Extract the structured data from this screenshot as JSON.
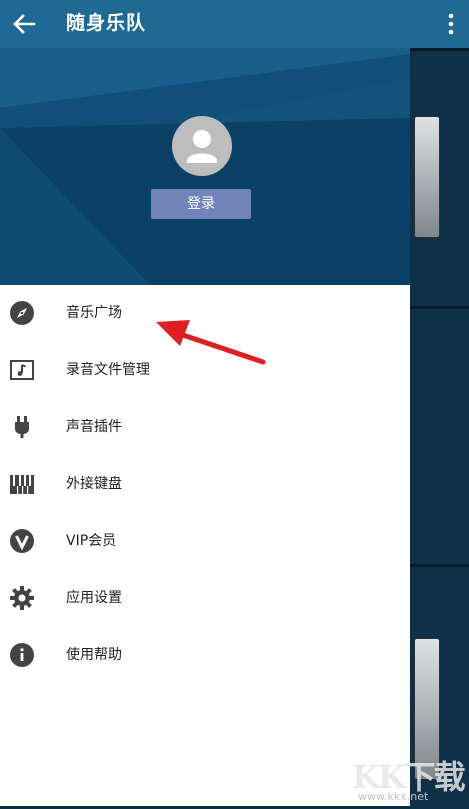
{
  "appbar": {
    "title": "随身乐队",
    "back_icon": "arrow-back-icon",
    "more_icon": "more-vert-icon"
  },
  "drawer": {
    "login_label": "登录",
    "menu": [
      {
        "label": "音乐广场",
        "icon": "compass-icon"
      },
      {
        "label": "录音文件管理",
        "icon": "music-file-icon"
      },
      {
        "label": "声音插件",
        "icon": "plugin-icon"
      },
      {
        "label": "外接键盘",
        "icon": "piano-keyboard-icon"
      },
      {
        "label": "VIP会员",
        "icon": "vip-icon"
      },
      {
        "label": "应用设置",
        "icon": "gear-icon"
      },
      {
        "label": "使用帮助",
        "icon": "info-icon"
      }
    ]
  },
  "colors": {
    "appbar": "#1e6a94",
    "header": "#0e4a72",
    "login": "#7285ba",
    "icon": "#444444",
    "arrow": "#e02020"
  },
  "watermark": {
    "logo": "KK下载",
    "url": "www.kkx.net"
  }
}
